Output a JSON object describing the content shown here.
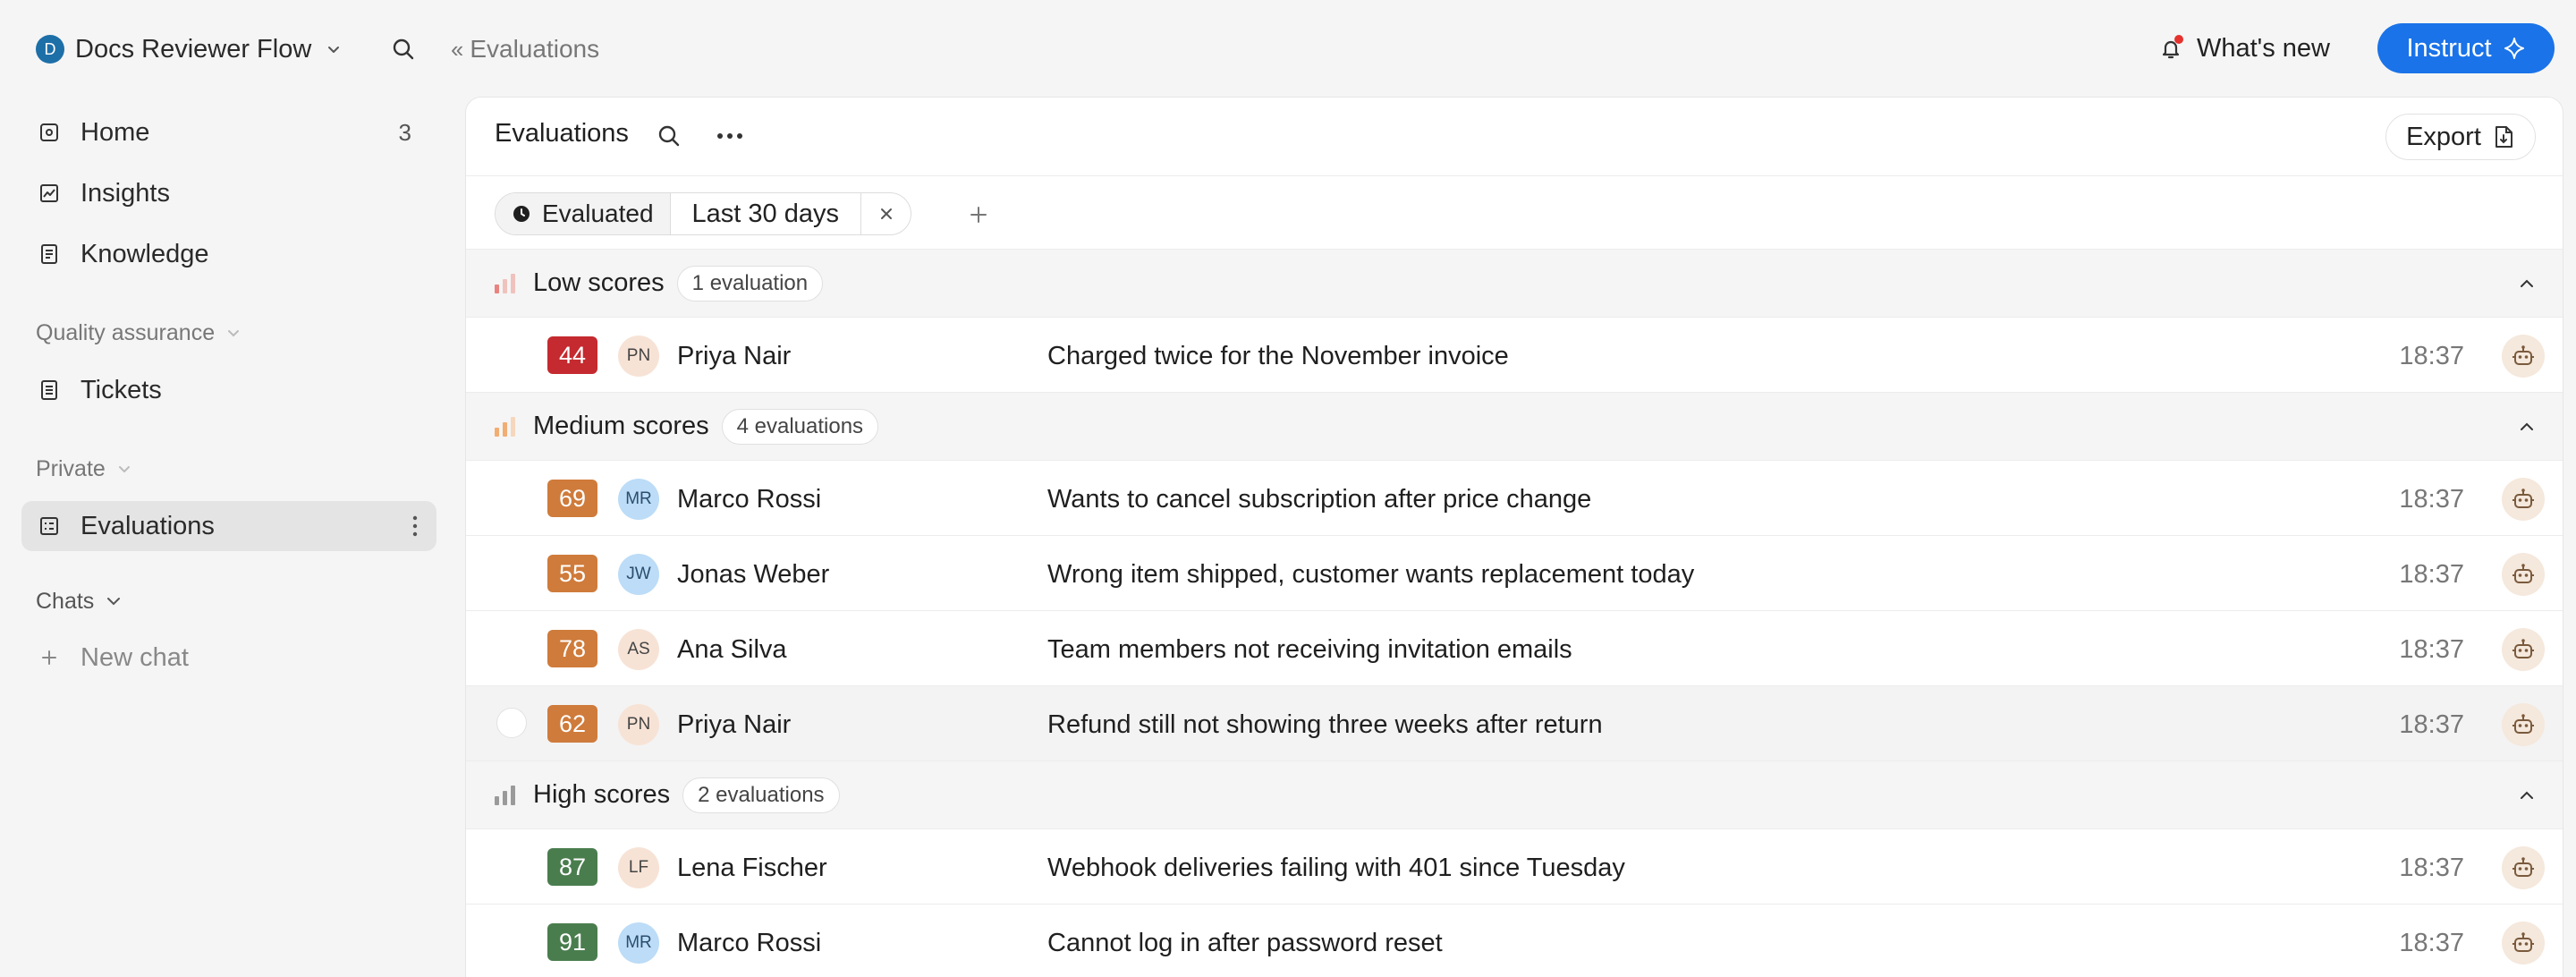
{
  "workspace": {
    "initial": "D",
    "name": "Docs Reviewer Flow"
  },
  "breadcrumb": {
    "glyph": "‹‹",
    "label": "Evaluations"
  },
  "topbar": {
    "whats_new": "What's new",
    "instruct": "Instruct"
  },
  "sidebar": {
    "home": {
      "label": "Home",
      "count": "3"
    },
    "insights": {
      "label": "Insights"
    },
    "knowledge": {
      "label": "Knowledge"
    },
    "qa_section": "Quality assurance",
    "tickets": {
      "label": "Tickets"
    },
    "private_section": "Private",
    "evaluations": {
      "label": "Evaluations"
    },
    "chats_section": "Chats",
    "new_chat": "New chat"
  },
  "panel": {
    "title": "Evaluations",
    "export_label": "Export",
    "filter": {
      "field": "Evaluated",
      "value": "Last 30 days"
    }
  },
  "colors": {
    "accent": "#1a73e8",
    "score_low": "#c42a2f",
    "score_medium": "#cf7b3b",
    "score_high": "#4a7d4e",
    "notification": "#e5322d"
  },
  "groups": [
    {
      "title": "Low scores",
      "count_label": "1 evaluation",
      "rows": [
        {
          "score": "44",
          "initials": "PN",
          "name": "Priya Nair",
          "subject": "Charged twice for the November invoice",
          "time": "18:37"
        }
      ]
    },
    {
      "title": "Medium scores",
      "count_label": "4 evaluations",
      "rows": [
        {
          "score": "69",
          "initials": "MR",
          "name": "Marco Rossi",
          "subject": "Wants to cancel subscription after price change",
          "time": "18:37"
        },
        {
          "score": "55",
          "initials": "JW",
          "name": "Jonas Weber",
          "subject": "Wrong item shipped, customer wants replacement today",
          "time": "18:37"
        },
        {
          "score": "78",
          "initials": "AS",
          "name": "Ana Silva",
          "subject": "Team members not receiving invitation emails",
          "time": "18:37"
        },
        {
          "score": "62",
          "initials": "PN",
          "name": "Priya Nair",
          "subject": "Refund still not showing three weeks after return",
          "time": "18:37"
        }
      ]
    },
    {
      "title": "High scores",
      "count_label": "2 evaluations",
      "rows": [
        {
          "score": "87",
          "initials": "LF",
          "name": "Lena Fischer",
          "subject": "Webhook deliveries failing with 401 since Tuesday",
          "time": "18:37"
        },
        {
          "score": "91",
          "initials": "MR",
          "name": "Marco Rossi",
          "subject": "Cannot log in after password reset",
          "time": "18:37"
        }
      ]
    }
  ]
}
